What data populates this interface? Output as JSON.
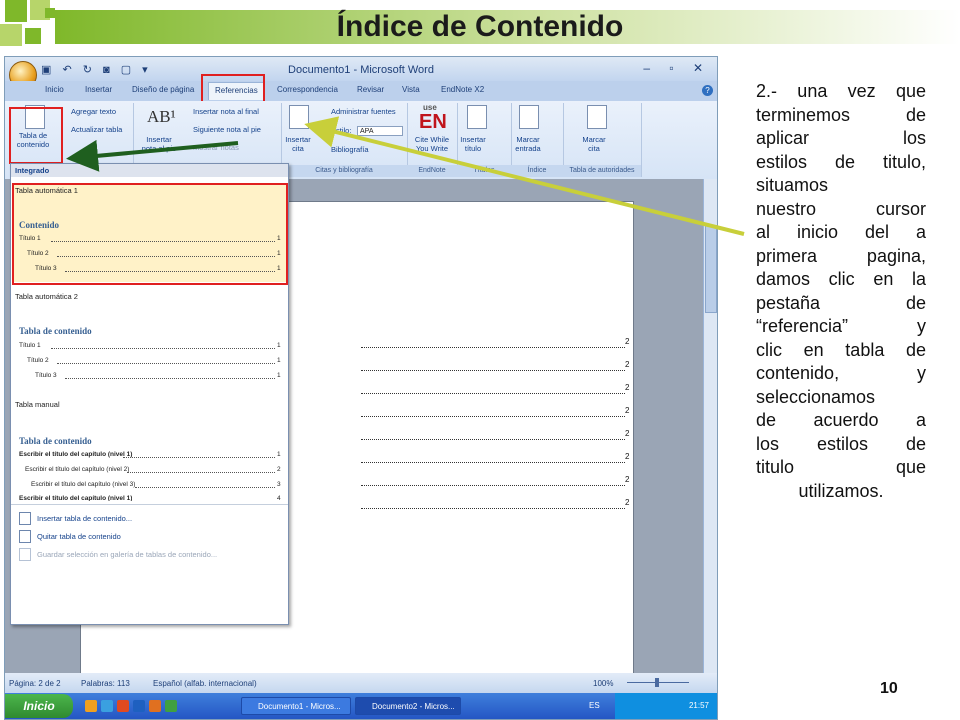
{
  "slide": {
    "title": "Índice de Contenido",
    "page_number": "10",
    "paragraph_lines": [
      "2.- una vez que",
      "terminemos de",
      "aplicar los",
      "estilos de titulo,",
      "situamos",
      "nuestro cursor",
      "al inicio del a",
      "primera pagina,",
      "damos clic en la",
      "pestaña de",
      "“referencia” y",
      "clic en tabla de",
      "contenido, y",
      "seleccionamos",
      "de acuerdo a",
      "los estilos de",
      "titulo que",
      "utilizamos."
    ],
    "colors": {
      "arrow_green": "#1f5f1f",
      "arrow_yellow": "#c8cf3a",
      "highlight_red": "#e02020",
      "header_green": "#7fb82a"
    }
  },
  "word": {
    "window_title": "Documento1 - Microsoft Word",
    "tabs": [
      "Inicio",
      "Insertar",
      "Diseño de página",
      "Referencias",
      "Correspondencia",
      "Revisar",
      "Vista",
      "EndNote X2"
    ],
    "active_tab": "Referencias",
    "ribbon": {
      "toc_button": "Tabla de contenido",
      "add_text": "Agregar texto",
      "update_table": "Actualizar tabla",
      "insert_endnote": "Insertar nota al final",
      "next_footnote": "Siguiente nota al pie",
      "insert_footnote": "Insertar nota al pie",
      "show_notes": "Mostrar notas",
      "insert_citation": "Insertar cita",
      "manage_sources": "Administrar fuentes",
      "style_label": "Estilo:",
      "style_value": "APA",
      "bibliography": "Bibliografía",
      "cite_while_write": "Cite While You Write",
      "insert_caption": "Insertar título",
      "mark_entry": "Marcar entrada",
      "mark_citation": "Marcar cita",
      "endnote_icon_top": "use",
      "endnote_icon_main": "EN",
      "group_citations": "Citas y bibliografía",
      "group_endnote": "EndNote",
      "group_titles": "Títulos",
      "group_index": "Índice",
      "group_authorities": "Tabla de autoridades"
    },
    "gallery": {
      "section_builtin": "Integrado",
      "auto1": {
        "name": "Tabla automática 1",
        "heading": "Contenido",
        "entries": [
          "Título 1",
          "Título 2",
          "Título 3"
        ],
        "page": "1"
      },
      "auto2": {
        "name": "Tabla automática 2",
        "heading": "Tabla de contenido",
        "entries": [
          "Título 1",
          "Título 2",
          "Título 3"
        ],
        "page": "1"
      },
      "manual": {
        "name": "Tabla manual",
        "heading": "Tabla de contenido",
        "entries": [
          "Escribir el título del capítulo (nivel 1)",
          "Escribir el título del capítulo (nivel 2)",
          "Escribir el título del capítulo (nivel 3)",
          "Escribir el título del capítulo (nivel 1)"
        ],
        "pages": [
          "1",
          "2",
          "3",
          "4"
        ]
      },
      "commands": [
        "Insertar tabla de contenido...",
        "Quitar tabla de contenido",
        "Guardar selección en galería de tablas de contenido..."
      ]
    },
    "doc_toc_pages": [
      "2",
      "2",
      "2",
      "2",
      "2",
      "2",
      "2",
      "2"
    ],
    "status": {
      "page": "Página: 2 de 2",
      "words": "Palabras: 113",
      "language": "Español (alfab. internacional)",
      "zoom": "100%"
    },
    "taskbar": {
      "start": "Inicio",
      "task1": "Documento1 - Micros...",
      "task2": "Documento2 - Micros...",
      "lang": "ES",
      "time": "21:57"
    }
  }
}
